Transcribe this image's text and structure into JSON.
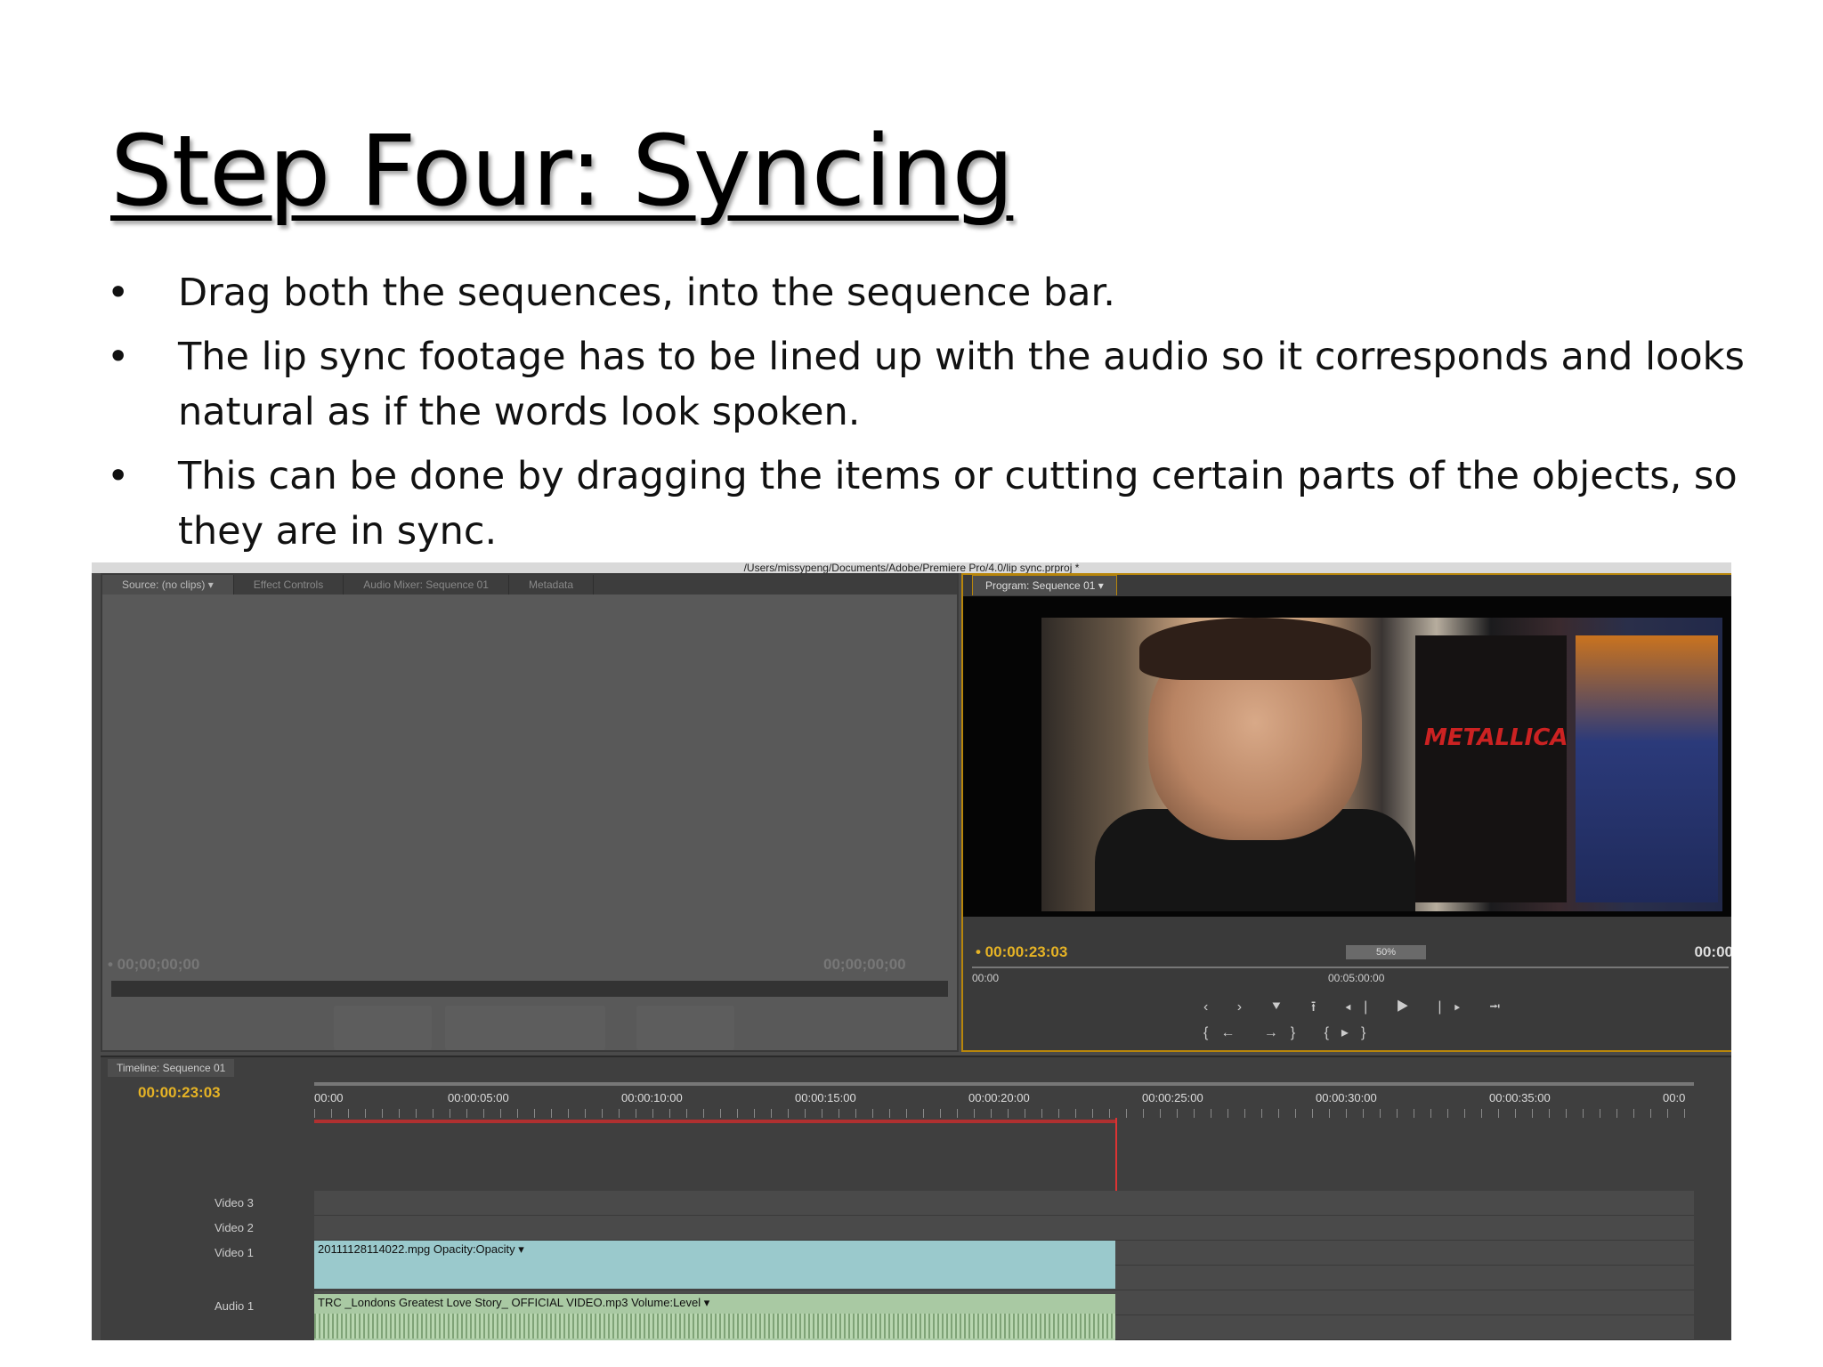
{
  "slide": {
    "title": "Step Four: Syncing",
    "bullets": [
      "Drag both the sequences, into the sequence bar.",
      "The lip sync footage has to be lined up with the audio so it corresponds and looks natural as if the words look spoken.",
      "This can be done by dragging the items or cutting certain parts of the objects, so they are in sync."
    ],
    "bullet_symbol": "•"
  },
  "screenshot": {
    "path": "/Users/missypeng/Documents/Adobe/Premiere Pro/4.0/lip sync.prproj *",
    "source_tabs": [
      "Source: (no clips) ▾",
      "Effect Controls",
      "Audio Mixer: Sequence 01",
      "Metadata"
    ],
    "source_tc_in": "• 00;00;00;00",
    "source_tc_out": "00;00;00;00",
    "program_tab": "Program: Sequence 01 ▾",
    "poster_text": "METALLICA",
    "program_tc": "• 00:00:23:03",
    "zoom": "50%",
    "program_tc_end": "00:00",
    "program_ruler": [
      "00:00",
      "00:05:00:00"
    ],
    "transport_row1": "‹ › ⯆ ⭱ ◂| ▶ |▸ ⭲",
    "transport_row2": "{← →} {▸}",
    "timeline_tab": "Timeline: Sequence 01",
    "timeline_tc": "00:00:23:03",
    "ruler_ticks": [
      "00:00",
      "00:00:05:00",
      "00:00:10:00",
      "00:00:15:00",
      "00:00:20:00",
      "00:00:25:00",
      "00:00:30:00",
      "00:00:35:00",
      "00:0"
    ],
    "tracks": [
      "Video 3",
      "Video 2",
      "Video 1",
      "Audio 1"
    ],
    "video_clip": "20111128114022.mpg  Opacity:Opacity ▾",
    "audio_clip": "TRC _Londons Greatest Love Story_ OFFICIAL VIDEO.mp3  Volume:Level ▾"
  }
}
